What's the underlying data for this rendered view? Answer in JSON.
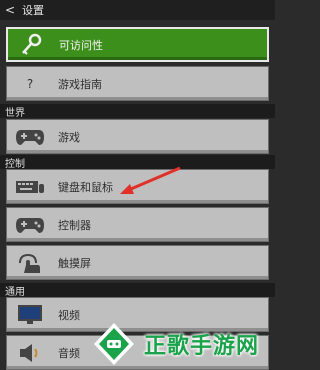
{
  "header": {
    "back_icon": "back-arrow-icon",
    "title": "设置"
  },
  "sections": {
    "world": "世界",
    "controls": "控制",
    "general": "通用"
  },
  "items": [
    {
      "label": "可访问性",
      "icon": "key-icon",
      "selected": true
    },
    {
      "label": "游戏指南",
      "icon": "question-icon"
    },
    {
      "label": "游戏",
      "icon": "gamepad-icon"
    },
    {
      "label": "键盘和鼠标",
      "icon": "keyboard-icon"
    },
    {
      "label": "控制器",
      "icon": "controller-icon"
    },
    {
      "label": "触摸屏",
      "icon": "touch-icon"
    },
    {
      "label": "视频",
      "icon": "monitor-icon"
    },
    {
      "label": "音频",
      "icon": "speaker-icon"
    }
  ],
  "watermark": {
    "text": "正歌手游网"
  },
  "colors": {
    "selected_bg": "#3d8f1b",
    "item_bg": "#bfbfbf",
    "annotation_arrow": "#e0302a",
    "watermark_text": "#1aa34a"
  }
}
